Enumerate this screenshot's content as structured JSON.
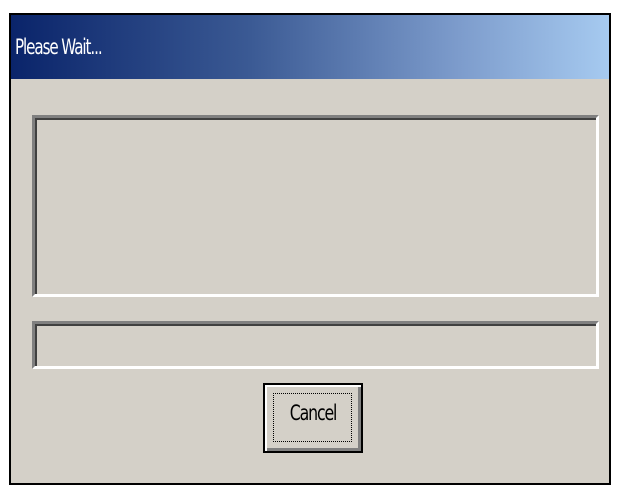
{
  "window": {
    "title": "Please Wait..."
  },
  "dialog": {
    "message": "",
    "progress": 0,
    "cancel_label": "Cancel"
  },
  "colors": {
    "title_bar_start": "#0a246a",
    "title_bar_end": "#a6caf0",
    "face": "#d4d0c8"
  }
}
